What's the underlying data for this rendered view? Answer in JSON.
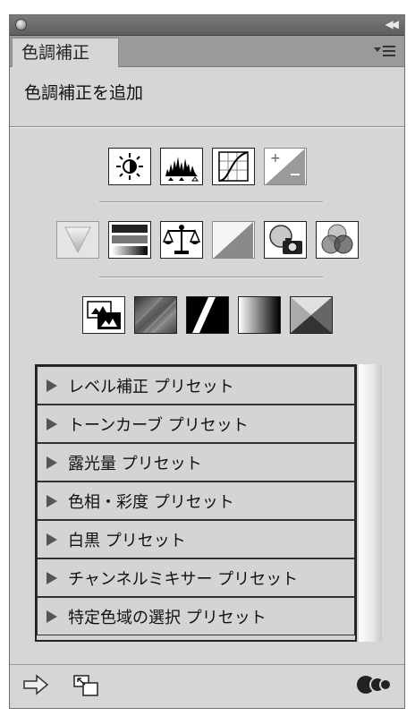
{
  "panel": {
    "tab_label": "色調補正",
    "heading": "色調補正を追加"
  },
  "icon_rows": [
    [
      "brightness-contrast-icon",
      "levels-icon",
      "curves-icon",
      "exposure-icon"
    ],
    [
      "vibrance-icon",
      "hue-saturation-icon",
      "color-balance-icon",
      "black-white-icon",
      "photo-filter-icon",
      "channel-mixer-icon"
    ],
    [
      "invert-icon",
      "posterize-icon",
      "threshold-icon",
      "gradient-map-icon",
      "selective-color-icon"
    ]
  ],
  "presets": [
    "レベル補正 プリセット",
    "トーンカーブ プリセット",
    "露光量 プリセット",
    "色相・彩度 プリセット",
    "白黒 プリセット",
    "チャンネルミキサー プリセット",
    "特定色域の選択 プリセット"
  ]
}
